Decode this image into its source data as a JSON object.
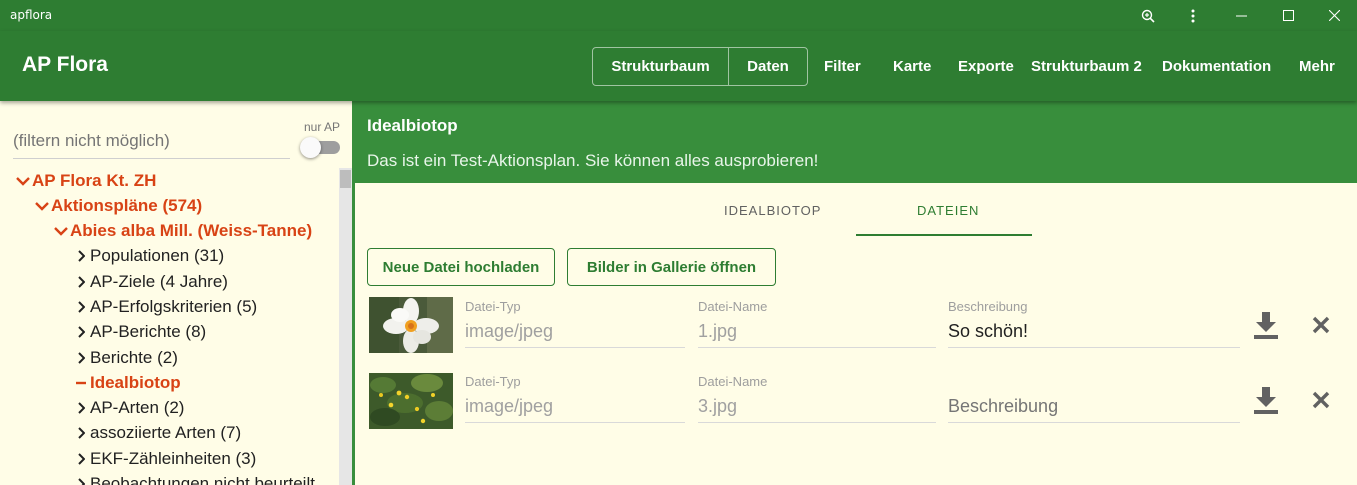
{
  "window": {
    "title": "apflora",
    "buttons": [
      "zoom-icon",
      "more-vert-icon",
      "minimize-icon",
      "maximize-icon",
      "close-icon"
    ]
  },
  "appbar": {
    "title": "AP Flora",
    "nav": [
      "Strukturbaum",
      "Daten",
      "Filter",
      "Karte",
      "Exporte",
      "Strukturbaum 2",
      "Dokumentation",
      "Mehr"
    ]
  },
  "tree": {
    "filter_placeholder": "(filtern nicht möglich)",
    "only_ap_label": "nur AP",
    "only_ap_checked": false,
    "nodes": [
      {
        "label": "AP Flora Kt. ZH",
        "state": "open"
      },
      {
        "label": "Aktionspläne (574)",
        "state": "open"
      },
      {
        "label": "Abies alba Mill. (Weiss-Tanne)",
        "state": "open"
      },
      {
        "label": "Populationen (31)",
        "state": "closed"
      },
      {
        "label": "AP-Ziele (4 Jahre)",
        "state": "closed"
      },
      {
        "label": "AP-Erfolgskriterien (5)",
        "state": "closed"
      },
      {
        "label": "AP-Berichte (8)",
        "state": "closed"
      },
      {
        "label": "Berichte (2)",
        "state": "closed"
      },
      {
        "label": "Idealbiotop",
        "state": "active"
      },
      {
        "label": "AP-Arten (2)",
        "state": "closed"
      },
      {
        "label": "assoziierte Arten (7)",
        "state": "closed"
      },
      {
        "label": "EKF-Zähleinheiten (3)",
        "state": "closed"
      },
      {
        "label": "Beobachtungen nicht beurteilt",
        "state": "closed"
      }
    ]
  },
  "detail": {
    "title": "Idealbiotop",
    "subtitle": "Das ist ein Test-Aktionsplan. Sie können alles ausprobieren!",
    "tabs": [
      "IDEALBIOTOP",
      "DATEIEN"
    ],
    "active_tab": "DATEIEN",
    "upload_button": "Neue Datei hochladen",
    "gallery_button": "Bilder in Gallerie öffnen",
    "files": [
      {
        "thumbnail": "white-narcissus-flower",
        "type_label": "Datei-Typ",
        "type": "image/jpeg",
        "name_label": "Datei-Name",
        "name": "1.jpg",
        "desc_label": "Beschreibung",
        "description": "So schön!"
      },
      {
        "thumbnail": "green-plants-yellow-flowers",
        "type_label": "Datei-Typ",
        "type": "image/jpeg",
        "name_label": "Datei-Name",
        "name": "3.jpg",
        "desc_label": "",
        "description": "Beschreibung"
      }
    ]
  },
  "colors": {
    "primary": "#2e7d32",
    "primary_light": "#388e3c",
    "accent": "#d84315",
    "background": "#fffde7"
  }
}
